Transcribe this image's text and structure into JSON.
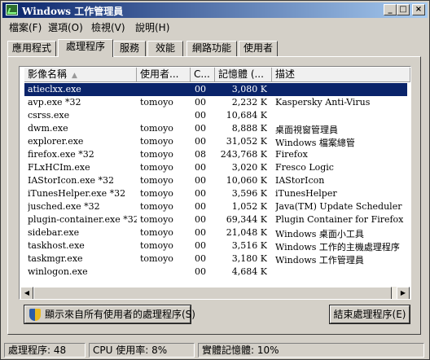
{
  "window": {
    "title": "Windows 工作管理員",
    "min_glyph": "_",
    "max_glyph": "□",
    "close_glyph": "×"
  },
  "menu": {
    "items": [
      "檔案(F)",
      "選項(O)",
      "檢視(V)",
      "說明(H)"
    ]
  },
  "tabs": {
    "items": [
      "應用程式",
      "處理程序",
      "服務",
      "效能",
      "網路功能",
      "使用者"
    ],
    "active": 1
  },
  "table": {
    "columns": [
      "影像名稱",
      "使用者...",
      "C...",
      "記憶體 (...",
      "描述"
    ],
    "rows": [
      {
        "name": "atieclxx.exe",
        "user": "",
        "cpu": "00",
        "mem": "3,080 K",
        "desc": "",
        "selected": true
      },
      {
        "name": "avp.exe *32",
        "user": "tomoyo",
        "cpu": "00",
        "mem": "2,232 K",
        "desc": "Kaspersky Anti-Virus"
      },
      {
        "name": "csrss.exe",
        "user": "",
        "cpu": "00",
        "mem": "10,684 K",
        "desc": ""
      },
      {
        "name": "dwm.exe",
        "user": "tomoyo",
        "cpu": "00",
        "mem": "8,888 K",
        "desc": "桌面視窗管理員"
      },
      {
        "name": "explorer.exe",
        "user": "tomoyo",
        "cpu": "00",
        "mem": "31,052 K",
        "desc": "Windows 檔案總管"
      },
      {
        "name": "firefox.exe *32",
        "user": "tomoyo",
        "cpu": "08",
        "mem": "243,768 K",
        "desc": "Firefox"
      },
      {
        "name": "FLxHCIm.exe",
        "user": "tomoyo",
        "cpu": "00",
        "mem": "3,020 K",
        "desc": "Fresco Logic"
      },
      {
        "name": "IAStorIcon.exe *32",
        "user": "tomoyo",
        "cpu": "00",
        "mem": "10,060 K",
        "desc": "IAStorIcon"
      },
      {
        "name": "iTunesHelper.exe *32",
        "user": "tomoyo",
        "cpu": "00",
        "mem": "3,596 K",
        "desc": "iTunesHelper"
      },
      {
        "name": "jusched.exe *32",
        "user": "tomoyo",
        "cpu": "00",
        "mem": "1,052 K",
        "desc": "Java(TM) Update Scheduler"
      },
      {
        "name": "plugin-container.exe *32",
        "user": "tomoyo",
        "cpu": "00",
        "mem": "69,344 K",
        "desc": "Plugin Container for Firefox"
      },
      {
        "name": "sidebar.exe",
        "user": "tomoyo",
        "cpu": "00",
        "mem": "21,048 K",
        "desc": "Windows 桌面小工具"
      },
      {
        "name": "taskhost.exe",
        "user": "tomoyo",
        "cpu": "00",
        "mem": "3,516 K",
        "desc": "Windows 工作的主機處理程序"
      },
      {
        "name": "taskmgr.exe",
        "user": "tomoyo",
        "cpu": "00",
        "mem": "3,180 K",
        "desc": "Windows 工作管理員"
      },
      {
        "name": "winlogon.exe",
        "user": "",
        "cpu": "00",
        "mem": "4,684 K",
        "desc": ""
      }
    ]
  },
  "buttons": {
    "show_all": "顯示來自所有使用者的處理程序(S)",
    "end_process": "結束處理程序(E)"
  },
  "status": {
    "processes": "處理程序: 48",
    "cpu": "CPU 使用率: 8%",
    "memory": "實體記憶體: 10%"
  }
}
